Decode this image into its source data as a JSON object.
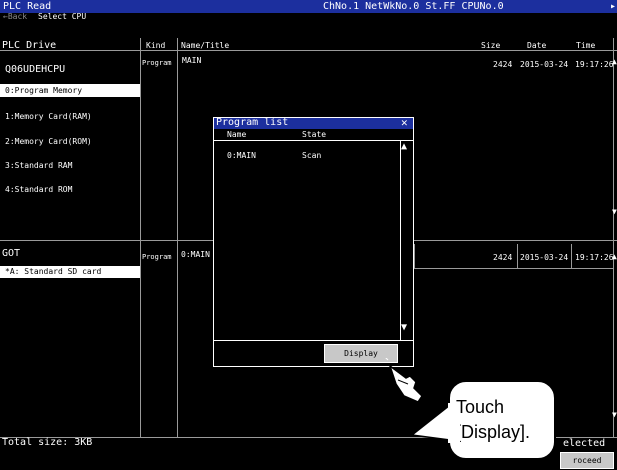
{
  "title_bar": {
    "left": "PLC Read",
    "center": "ChNo.1 NetWkNo.0 St.FF CPUNo.0"
  },
  "toolbar": {
    "back_label": "←Back",
    "select_label": "Select CPU"
  },
  "header": {
    "plc_drive": "PLC Drive",
    "kind": "Kind",
    "name_title": "Name/Title",
    "size": "Size",
    "date": "Date",
    "time": "Time"
  },
  "plc": {
    "cpu_name": "Q06UDEHCPU",
    "drives": [
      "0:Program Memory",
      "1:Memory Card(RAM)",
      "2:Memory Card(ROM)",
      "3:Standard RAM",
      "4:Standard ROM"
    ],
    "selected_drive_index": 0,
    "row": {
      "kind": "Program",
      "name": "MAIN",
      "size": "2424",
      "date": "2015-03-24",
      "time": "19:17:26"
    }
  },
  "got": {
    "name": "GOT",
    "drive": "*A: Standard SD card",
    "row": {
      "kind": "Program",
      "name": "0:MAIN",
      "size": "2424",
      "date": "2015-03-24",
      "time": "19:17:26"
    }
  },
  "footer": {
    "total_size": "Total size: 3KB",
    "selected_fragment": "elected",
    "proceed_fragment": "roceed"
  },
  "dialog": {
    "title": "Program list",
    "col_name": "Name",
    "col_state": "State",
    "items": [
      {
        "name": "0:MAIN",
        "state": "Scan"
      }
    ],
    "display_button": "Display",
    "close_symbol": "✕"
  },
  "callout": {
    "line1": "Touch",
    "line2": "[Display]."
  },
  "colors": {
    "title_bar": "#1c2f9e",
    "background": "#000000",
    "selection": "#ffffff",
    "button": "#c8c8c8"
  }
}
